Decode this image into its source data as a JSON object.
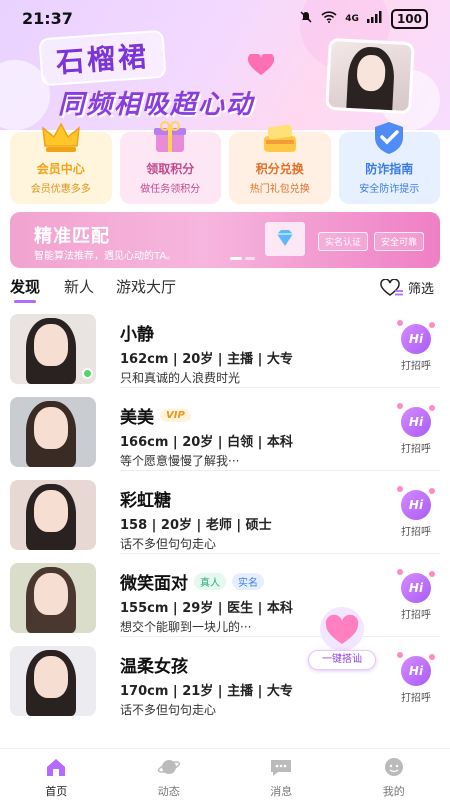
{
  "status": {
    "time": "21:37",
    "signal": "4G",
    "battery": "100"
  },
  "banner": {
    "title": "石榴裙",
    "slogan": "同频相吸超心动"
  },
  "features": [
    {
      "title": "会员中心",
      "subtitle": "会员优惠多多",
      "color": "#f0a415",
      "bg": "#fff5dd",
      "icon": "crown-icon"
    },
    {
      "title": "领取积分",
      "subtitle": "做任务领积分",
      "color": "#c24a8e",
      "bg": "#fde7f4",
      "icon": "gift-icon"
    },
    {
      "title": "积分兑换",
      "subtitle": "热门礼包兑换",
      "color": "#e0702b",
      "bg": "#fff0e3",
      "icon": "gift-box-icon"
    },
    {
      "title": "防诈指南",
      "subtitle": "安全防诈提示",
      "color": "#3a7be6",
      "bg": "#e7f0ff",
      "icon": "shield-icon"
    }
  ],
  "match": {
    "title": "精准匹配",
    "subtitle": "智能算法推荐，遇见心动的TA。",
    "pill1": "实名认证",
    "pill2": "安全可靠"
  },
  "tabs": {
    "discover": "发现",
    "newbies": "新人",
    "games": "游戏大厅",
    "filter": "筛选"
  },
  "users": [
    {
      "name": "小静",
      "info": "162cm | 20岁 | 主播 | 大专",
      "bio": "只和真诚的人浪费时光",
      "online": true,
      "vip": "",
      "real": "",
      "auth": "",
      "greet": "打招呼",
      "bg": "#e9e4e2"
    },
    {
      "name": "美美",
      "info": "166cm | 20岁 | 白领 | 本科",
      "bio": "等个愿意慢慢了解我···",
      "online": false,
      "vip": "VIP",
      "real": "",
      "auth": "",
      "greet": "打招呼",
      "bg": "#c9ccd1"
    },
    {
      "name": "彩虹糖",
      "info": "158 | 20岁 | 老师 | 硕士",
      "bio": "话不多但句句走心",
      "online": false,
      "vip": "",
      "real": "",
      "auth": "",
      "greet": "打招呼",
      "bg": "#e8d8d4"
    },
    {
      "name": "微笑面对",
      "info": "155cm | 29岁 | 医生 | 本科",
      "bio": "想交个能聊到一块儿的···",
      "online": false,
      "vip": "",
      "real": "真人",
      "auth": "实名",
      "greet": "打招呼",
      "bg": "#d9ddc9"
    },
    {
      "name": "温柔女孩",
      "info": "170cm | 21岁 | 主播 | 大专",
      "bio": "话不多但句句走心",
      "online": false,
      "vip": "",
      "real": "",
      "auth": "",
      "greet": "打招呼",
      "bg": "#ececf0"
    }
  ],
  "quick_chat": "一键搭讪",
  "navbar": [
    {
      "label": "首页",
      "icon": "home-icon"
    },
    {
      "label": "动态",
      "icon": "planet-icon"
    },
    {
      "label": "消息",
      "icon": "message-icon"
    },
    {
      "label": "我的",
      "icon": "profile-icon"
    }
  ],
  "colors": {
    "accent": "#b56aff",
    "title": "#7b34d8"
  }
}
